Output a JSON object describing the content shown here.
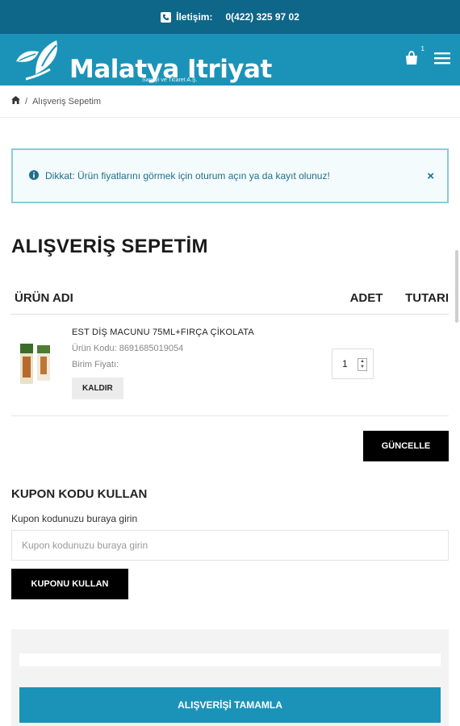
{
  "topbar": {
    "contact_label": "İletişim:",
    "phone": "0(422) 325 97 02"
  },
  "header": {
    "brand": "Malatya Itriyat",
    "brand_sub": "Sanayi ve Ticaret A.Ş.",
    "cart_count": "1"
  },
  "breadcrumb": {
    "current": "Alışveriş Sepetim"
  },
  "alert": {
    "message": "Dikkat: Ürün fiyatlarını görmek için oturum açın ya da kayıt olunuz!",
    "close": "×"
  },
  "page": {
    "title": "ALIŞVERİŞ SEPETİM"
  },
  "table": {
    "col_name": "ÜRÜN ADI",
    "col_qty": "ADET",
    "col_total": "TUTARI"
  },
  "item": {
    "name": "EST DİŞ MACUNU 75ML+FIRÇA ÇİKOLATA",
    "code": "Ürün Kodu: 8691685019054",
    "unit_price": "Birim Fiyatı:",
    "remove": "KALDIR",
    "qty": "1"
  },
  "actions": {
    "update": "GÜNCELLE"
  },
  "coupon": {
    "title": "KUPON KODU KULLAN",
    "label": "Kupon kodunuzu buraya girin",
    "placeholder": "Kupon kodunuzu buraya girin",
    "button": "KUPONU KULLAN"
  },
  "summary": {
    "checkout": "ALIŞVERİŞİ TAMAMLA"
  },
  "colors": {
    "primary": "#1b93b8",
    "topbar": "#0e6688",
    "dark": "#000000"
  }
}
